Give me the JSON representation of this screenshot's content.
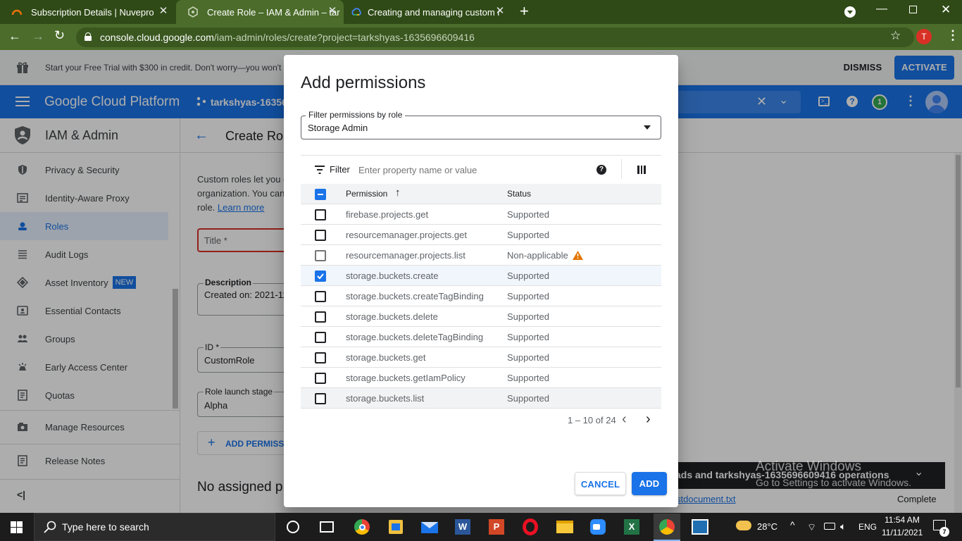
{
  "browser": {
    "tabs": [
      {
        "title": "Subscription Details | Nuvepro",
        "active": false
      },
      {
        "title": "Create Role – IAM & Admin – tar",
        "active": true
      },
      {
        "title": "Creating and managing custom r",
        "active": false
      }
    ],
    "url_host": "console.cloud.google.com",
    "url_path": "/iam-admin/roles/create?project=tarkshyas-1635696609416",
    "profile_initial": "T"
  },
  "promo": {
    "text": "Start your Free Trial with $300 in credit. Don't worry—you won't b",
    "dismiss": "DISMISS",
    "activate": "ACTIVATE"
  },
  "gcp": {
    "brand": "Google Cloud Platform",
    "project": "tarkshyas-16356",
    "notif_count": "1"
  },
  "sidebar": {
    "title": "IAM & Admin",
    "items": [
      {
        "label": "Privacy & Security",
        "icon": "shield-icon"
      },
      {
        "label": "Identity-Aware Proxy",
        "icon": "proxy-icon"
      },
      {
        "label": "Roles",
        "icon": "roles-icon",
        "selected": true
      },
      {
        "label": "Audit Logs",
        "icon": "list-icon"
      },
      {
        "label": "Asset Inventory",
        "icon": "inventory-icon",
        "badge": "NEW"
      },
      {
        "label": "Essential Contacts",
        "icon": "contacts-icon"
      },
      {
        "label": "Groups",
        "icon": "groups-icon"
      },
      {
        "label": "Early Access Center",
        "icon": "early-access-icon"
      },
      {
        "label": "Quotas",
        "icon": "quotas-icon"
      }
    ],
    "manage_resources": "Manage Resources",
    "release_notes": "Release Notes",
    "collapse": "<|"
  },
  "main": {
    "page_title": "Create Rol",
    "desc_line1": "Custom roles let you c",
    "desc_line2": "organization. You can",
    "desc_line3": "role.",
    "learn_more": "Learn more",
    "title_placeholder": "Title *",
    "description_label": "Description",
    "description_value": "Created on: 2021-11",
    "id_label": "ID *",
    "id_value": "CustomRole",
    "stage_label": "Role launch stage",
    "stage_value": "Alpha",
    "add_permissions": "ADD PERMISS",
    "no_assigned": "No assigned p"
  },
  "dialog": {
    "title": "Add permissions",
    "filter_role_label": "Filter permissions by role",
    "filter_role_value": "Storage Admin",
    "filter_label": "Filter",
    "filter_placeholder": "Enter property name or value",
    "col_permission": "Permission",
    "col_status": "Status",
    "rows": [
      {
        "permission": "firebase.projects.get",
        "status": "Supported",
        "checked": false
      },
      {
        "permission": "resourcemanager.projects.get",
        "status": "Supported",
        "checked": false
      },
      {
        "permission": "resourcemanager.projects.list",
        "status": "Non-applicable",
        "checked": false,
        "warning": true
      },
      {
        "permission": "storage.buckets.create",
        "status": "Supported",
        "checked": true
      },
      {
        "permission": "storage.buckets.createTagBinding",
        "status": "Supported",
        "checked": false
      },
      {
        "permission": "storage.buckets.delete",
        "status": "Supported",
        "checked": false
      },
      {
        "permission": "storage.buckets.deleteTagBinding",
        "status": "Supported",
        "checked": false
      },
      {
        "permission": "storage.buckets.get",
        "status": "Supported",
        "checked": false
      },
      {
        "permission": "storage.buckets.getIamPolicy",
        "status": "Supported",
        "checked": false
      },
      {
        "permission": "storage.buckets.list",
        "status": "Supported",
        "checked": false
      }
    ],
    "pagination": "1 – 10 of 24",
    "cancel": "CANCEL",
    "add": "ADD"
  },
  "notification": {
    "text": "ads and tarkshyas-1635696609416 operations",
    "file": "stdocument.txt",
    "status": "Complete"
  },
  "watermark": {
    "line1": "Activate Windows",
    "line2": "Go to Settings to activate Windows."
  },
  "taskbar": {
    "search": "Type here to search",
    "temp": "28°C",
    "lang": "ENG",
    "time": "11:54 AM",
    "date": "11/11/2021",
    "notif": "7"
  }
}
